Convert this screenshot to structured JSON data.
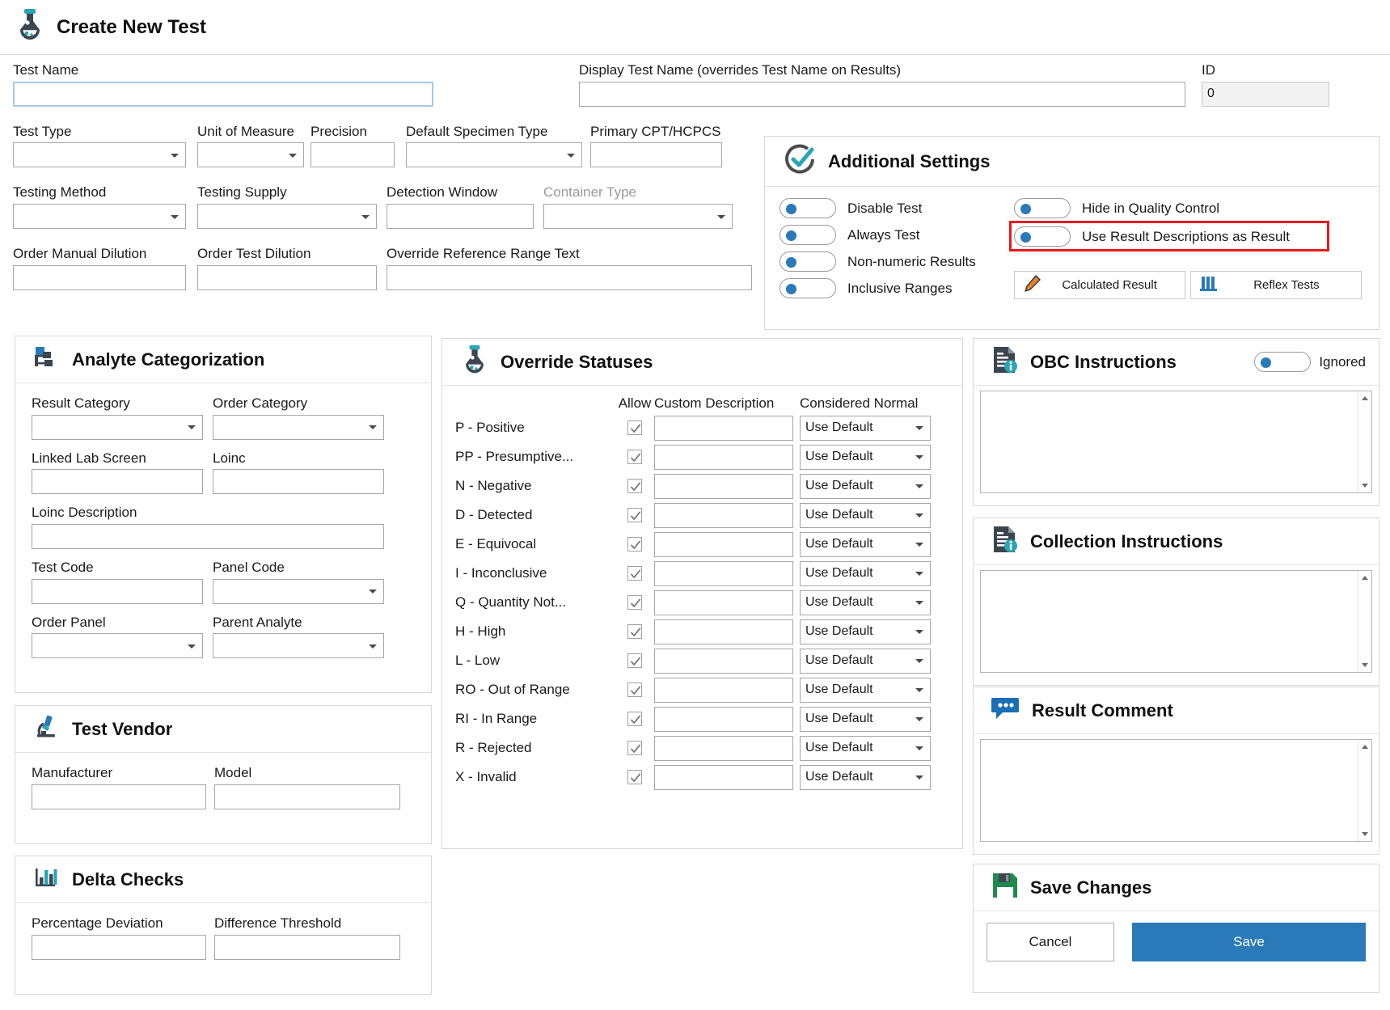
{
  "header": {
    "title": "Create New Test",
    "icon": "flask-icon"
  },
  "colors": {
    "accent_blue": "#2a7ab9",
    "teal": "#2aa5b5",
    "highlight_red": "#e8191b",
    "green": "#1f8a4c",
    "orange": "#e8821e"
  },
  "form": {
    "test_name": {
      "label": "Test Name",
      "value": ""
    },
    "display_test_name": {
      "label": "Display Test Name (overrides Test Name on Results)",
      "value": ""
    },
    "id": {
      "label": "ID",
      "value": "0"
    },
    "test_type": {
      "label": "Test Type",
      "value": ""
    },
    "unit_of_measure": {
      "label": "Unit of Measure",
      "value": ""
    },
    "precision": {
      "label": "Precision",
      "value": ""
    },
    "default_specimen_type": {
      "label": "Default Specimen Type",
      "value": ""
    },
    "primary_cpt": {
      "label": "Primary CPT/HCPCS",
      "value": ""
    },
    "testing_method": {
      "label": "Testing Method",
      "value": ""
    },
    "testing_supply": {
      "label": "Testing Supply",
      "value": ""
    },
    "detection_window": {
      "label": "Detection Window",
      "value": ""
    },
    "container_type": {
      "label": "Container Type",
      "value": ""
    },
    "order_manual_dilution": {
      "label": "Order Manual Dilution",
      "value": ""
    },
    "order_test_dilution": {
      "label": "Order Test Dilution",
      "value": ""
    },
    "override_reference_range_text": {
      "label": "Override Reference Range Text",
      "value": ""
    }
  },
  "additional_settings": {
    "title": "Additional Settings",
    "icon": "check-circle-icon",
    "toggles_left": [
      {
        "label": "Disable Test",
        "on": false
      },
      {
        "label": "Always Test",
        "on": false
      },
      {
        "label": "Non-numeric Results",
        "on": false
      },
      {
        "label": "Inclusive Ranges",
        "on": false
      }
    ],
    "toggles_right": [
      {
        "label": "Hide in Quality Control",
        "on": false,
        "highlighted": false
      },
      {
        "label": "Use Result Descriptions as Result",
        "on": false,
        "highlighted": true
      }
    ],
    "buttons": [
      {
        "label": "Calculated Result",
        "icon": "pencil-icon"
      },
      {
        "label": "Reflex Tests",
        "icon": "test-tubes-icon"
      }
    ]
  },
  "analyte_categorization": {
    "title": "Analyte Categorization",
    "icon": "hierarchy-icon",
    "fields": {
      "result_category": {
        "label": "Result Category",
        "value": "",
        "type": "select"
      },
      "order_category": {
        "label": "Order Category",
        "value": "",
        "type": "select"
      },
      "linked_lab_screen": {
        "label": "Linked Lab Screen",
        "value": "",
        "type": "text"
      },
      "loinc": {
        "label": "Loinc",
        "value": "",
        "type": "text"
      },
      "loinc_description": {
        "label": "Loinc Description",
        "value": "",
        "type": "text"
      },
      "test_code": {
        "label": "Test Code",
        "value": "",
        "type": "text"
      },
      "panel_code": {
        "label": "Panel Code",
        "value": "",
        "type": "select"
      },
      "order_panel": {
        "label": "Order Panel",
        "value": "",
        "type": "select"
      },
      "parent_analyte": {
        "label": "Parent Analyte",
        "value": "",
        "type": "select"
      }
    }
  },
  "test_vendor": {
    "title": "Test Vendor",
    "icon": "microscope-icon",
    "fields": {
      "manufacturer": {
        "label": "Manufacturer",
        "value": ""
      },
      "model": {
        "label": "Model",
        "value": ""
      }
    }
  },
  "delta_checks": {
    "title": "Delta Checks",
    "icon": "bar-chart-icon",
    "fields": {
      "percentage_deviation": {
        "label": "Percentage Deviation",
        "value": ""
      },
      "difference_threshold": {
        "label": "Difference Threshold",
        "value": ""
      }
    }
  },
  "override_statuses": {
    "title": "Override Statuses",
    "icon": "flask-icon",
    "columns": [
      "",
      "Allow",
      "Custom Description",
      "Considered Normal"
    ],
    "rows": [
      {
        "name": "P - Positive",
        "allow": true,
        "description": "",
        "considered_normal": "Use Default"
      },
      {
        "name": "PP - Presumptive...",
        "allow": true,
        "description": "",
        "considered_normal": "Use Default"
      },
      {
        "name": "N - Negative",
        "allow": true,
        "description": "",
        "considered_normal": "Use Default"
      },
      {
        "name": "D - Detected",
        "allow": true,
        "description": "",
        "considered_normal": "Use Default"
      },
      {
        "name": "E - Equivocal",
        "allow": true,
        "description": "",
        "considered_normal": "Use Default"
      },
      {
        "name": "I - Inconclusive",
        "allow": true,
        "description": "",
        "considered_normal": "Use Default"
      },
      {
        "name": "Q - Quantity Not...",
        "allow": true,
        "description": "",
        "considered_normal": "Use Default"
      },
      {
        "name": "H - High",
        "allow": true,
        "description": "",
        "considered_normal": "Use Default"
      },
      {
        "name": "L - Low",
        "allow": true,
        "description": "",
        "considered_normal": "Use Default"
      },
      {
        "name": "RO - Out of Range",
        "allow": true,
        "description": "",
        "considered_normal": "Use Default"
      },
      {
        "name": "RI - In Range",
        "allow": true,
        "description": "",
        "considered_normal": "Use Default"
      },
      {
        "name": "R - Rejected",
        "allow": true,
        "description": "",
        "considered_normal": "Use Default"
      },
      {
        "name": "X - Invalid",
        "allow": true,
        "description": "",
        "considered_normal": "Use Default"
      }
    ]
  },
  "obc_instructions": {
    "title": "OBC Instructions",
    "icon": "document-info-icon",
    "toggle_label": "Ignored",
    "toggle_on": false,
    "value": ""
  },
  "collection_instructions": {
    "title": "Collection Instructions",
    "icon": "document-info-icon",
    "value": ""
  },
  "result_comment": {
    "title": "Result Comment",
    "icon": "comment-icon",
    "value": ""
  },
  "save_changes": {
    "title": "Save Changes",
    "icon": "floppy-disk-icon",
    "cancel_label": "Cancel",
    "save_label": "Save"
  }
}
